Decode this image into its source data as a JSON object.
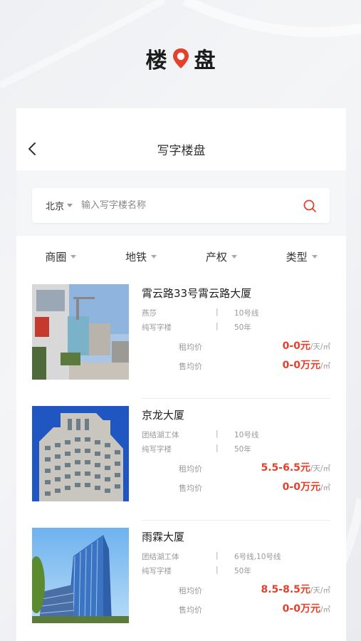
{
  "logo": {
    "left": "楼",
    "right": "盘",
    "accent_color": "#e4402c"
  },
  "nav": {
    "title": "写字楼盘",
    "back_icon": "chevron-left-icon"
  },
  "search": {
    "city": "北京",
    "placeholder": "输入写字楼名称",
    "value": "",
    "icon": "search-icon"
  },
  "filters": [
    {
      "label": "商圈"
    },
    {
      "label": "地铁"
    },
    {
      "label": "产权"
    },
    {
      "label": "类型"
    }
  ],
  "listings": [
    {
      "name": "霄云路33号霄云路大厦",
      "area": "燕莎",
      "subway": "10号线",
      "type": "纯写字楼",
      "tenure": "50年",
      "rent_label": "租均价",
      "rent_value": "0-0元",
      "rent_unit": "/天/㎡",
      "sale_label": "售均价",
      "sale_value": "0-0万元",
      "sale_unit": "/㎡"
    },
    {
      "name": "京龙大厦",
      "area": "团结湖工体",
      "subway": "10号线",
      "type": "纯写字楼",
      "tenure": "50年",
      "rent_label": "租均价",
      "rent_value": "5.5-6.5元",
      "rent_unit": "/天/㎡",
      "sale_label": "售均价",
      "sale_value": "0-0万元",
      "sale_unit": "/㎡"
    },
    {
      "name": "雨霖大厦",
      "area": "团结湖工体",
      "subway": "6号线,10号线",
      "type": "纯写字楼",
      "tenure": "50年",
      "rent_label": "租均价",
      "rent_value": "8.5-8.5元",
      "rent_unit": "/天/㎡",
      "sale_label": "售均价",
      "sale_value": "0-0万元",
      "sale_unit": "/㎡"
    }
  ]
}
